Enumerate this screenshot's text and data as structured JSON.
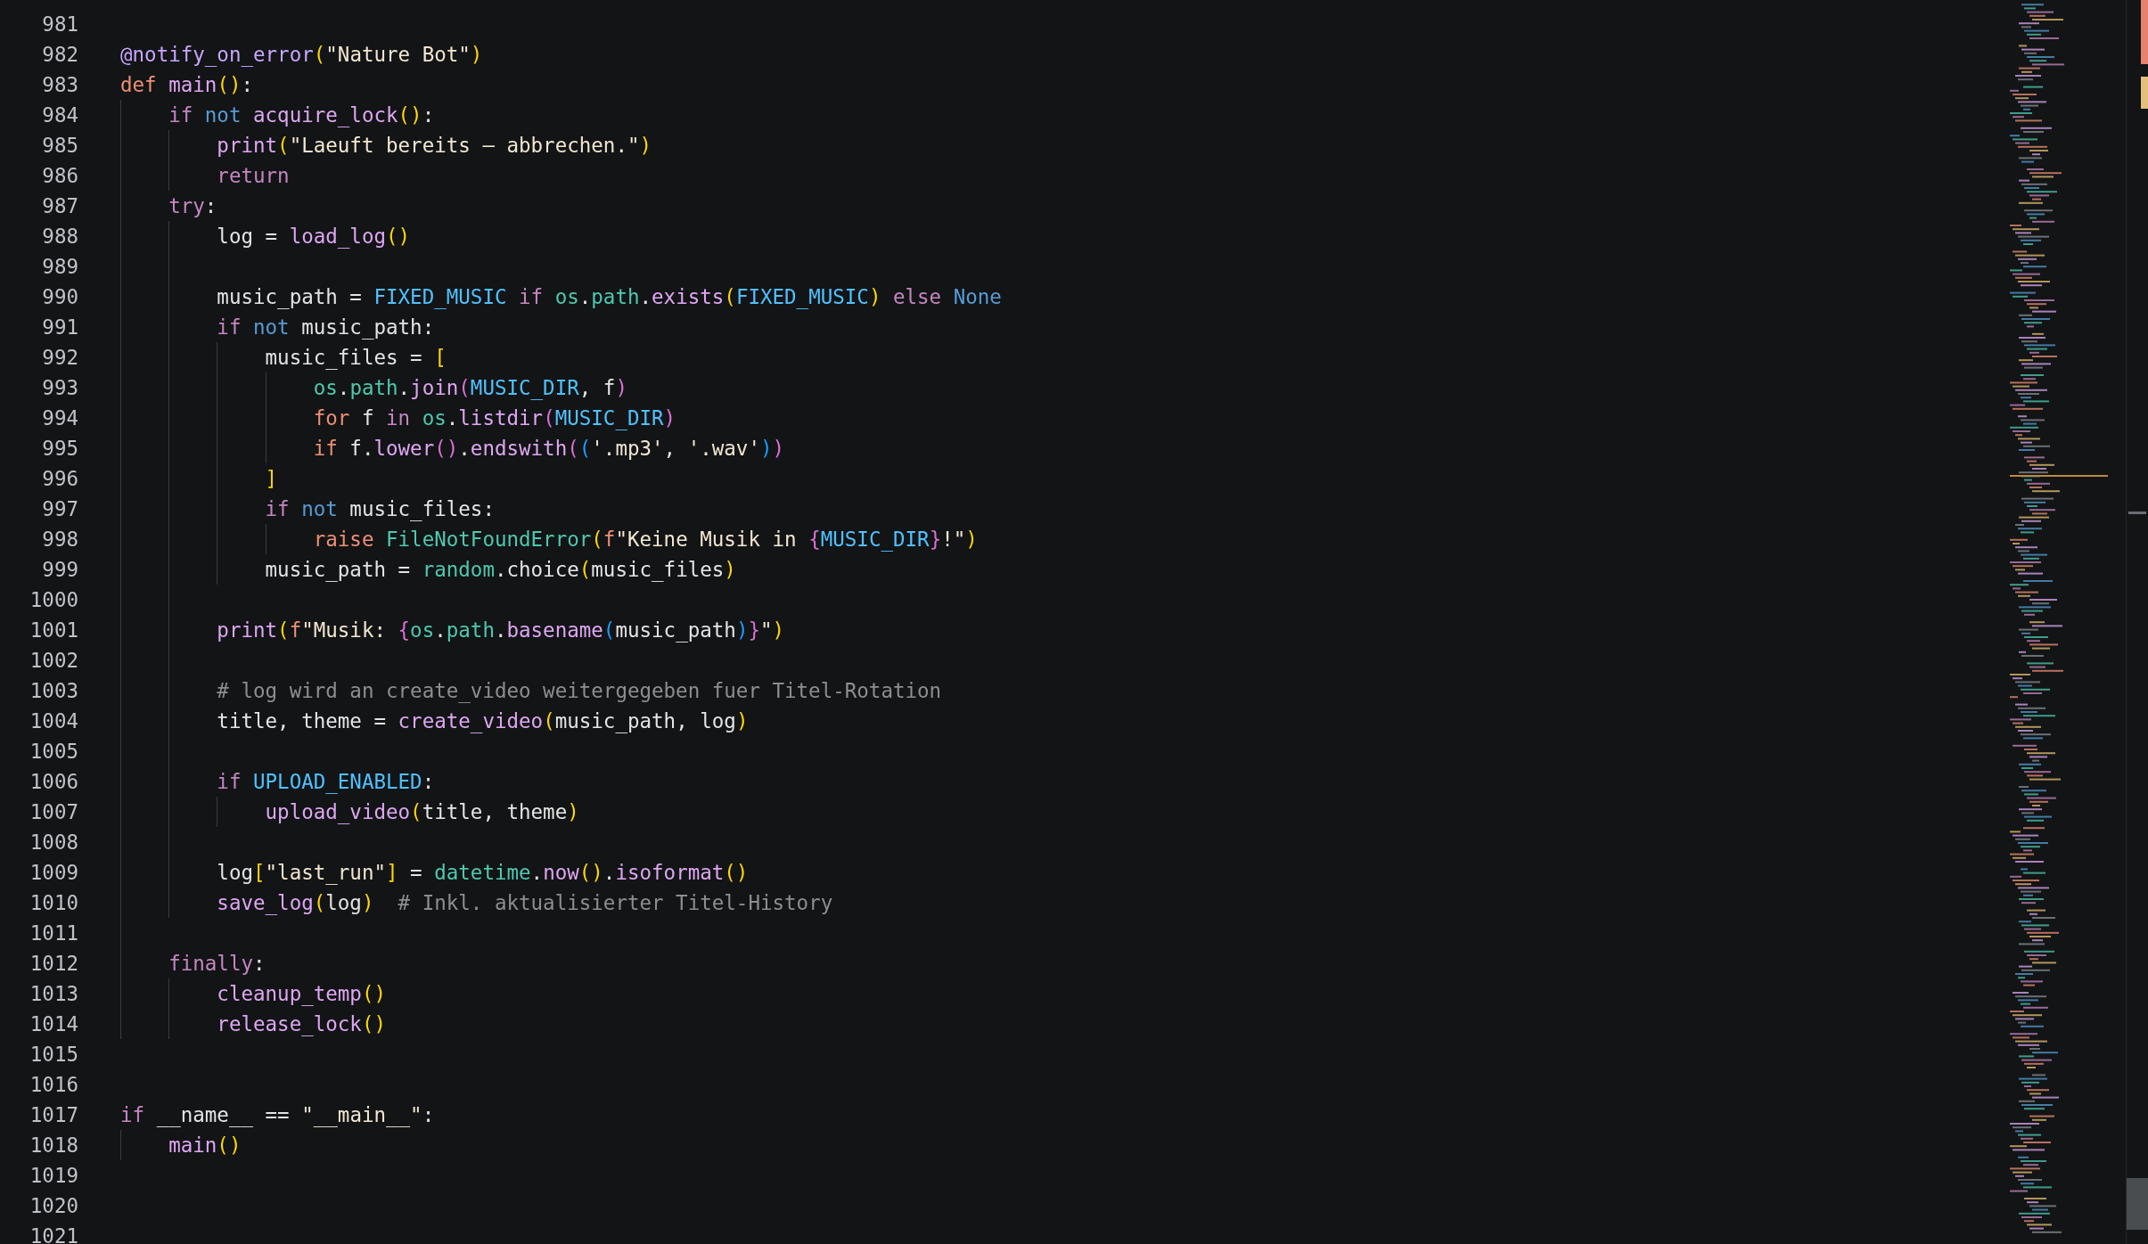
{
  "editor": {
    "lines": [
      {
        "number": "981"
      },
      {
        "number": "982",
        "tokens": [
          {
            "text": "@notify_on_error",
            "kind": "decorator"
          },
          {
            "text": "(",
            "kind": "bracket1"
          },
          {
            "text": "\"Nature Bot\"",
            "kind": "string"
          },
          {
            "text": ")",
            "kind": "bracket1"
          }
        ]
      },
      {
        "number": "983",
        "tokens": [
          {
            "text": "def ",
            "kind": "storage"
          },
          {
            "text": "main",
            "kind": "function"
          },
          {
            "text": "()",
            "kind": "bracket1"
          },
          {
            "text": ":",
            "kind": "plain"
          }
        ]
      },
      {
        "number": "984",
        "tokens": [
          {
            "text": "    if ",
            "kind": "control"
          },
          {
            "text": "not ",
            "kind": "operator"
          },
          {
            "text": "acquire_lock",
            "kind": "function"
          },
          {
            "text": "()",
            "kind": "bracket1"
          },
          {
            "text": ":",
            "kind": "plain"
          }
        ]
      },
      {
        "number": "985",
        "tokens": [
          {
            "text": "        print",
            "kind": "function"
          },
          {
            "text": "(",
            "kind": "bracket1"
          },
          {
            "text": "\"Laeuft bereits – abbrechen.\"",
            "kind": "string"
          },
          {
            "text": ")",
            "kind": "bracket1"
          }
        ]
      },
      {
        "number": "986",
        "tokens": [
          {
            "text": "        return",
            "kind": "control"
          }
        ]
      },
      {
        "number": "987",
        "tokens": [
          {
            "text": "    try",
            "kind": "control"
          },
          {
            "text": ":",
            "kind": "plain"
          }
        ]
      },
      {
        "number": "988",
        "tokens": [
          {
            "text": "        log = ",
            "kind": "plain"
          },
          {
            "text": "load_log",
            "kind": "function"
          },
          {
            "text": "()",
            "kind": "bracket1"
          }
        ]
      },
      {
        "number": "989"
      },
      {
        "number": "990",
        "tokens": [
          {
            "text": "        music_path = ",
            "kind": "plain"
          },
          {
            "text": "FIXED_MUSIC ",
            "kind": "constant"
          },
          {
            "text": "if ",
            "kind": "control"
          },
          {
            "text": "os",
            "kind": "module"
          },
          {
            "text": ".",
            "kind": "plain"
          },
          {
            "text": "path",
            "kind": "module"
          },
          {
            "text": ".",
            "kind": "plain"
          },
          {
            "text": "exists",
            "kind": "function"
          },
          {
            "text": "(",
            "kind": "bracket1"
          },
          {
            "text": "FIXED_MUSIC",
            "kind": "constant"
          },
          {
            "text": ") ",
            "kind": "bracket1"
          },
          {
            "text": "else ",
            "kind": "control"
          },
          {
            "text": "None",
            "kind": "operator"
          }
        ]
      },
      {
        "number": "991",
        "tokens": [
          {
            "text": "        if ",
            "kind": "control"
          },
          {
            "text": "not",
            "kind": "operator"
          },
          {
            "text": " music_path:",
            "kind": "plain"
          }
        ]
      },
      {
        "number": "992",
        "tokens": [
          {
            "text": "            music_files = ",
            "kind": "plain"
          },
          {
            "text": "[",
            "kind": "bracket1"
          }
        ]
      },
      {
        "number": "993",
        "tokens": [
          {
            "text": "                os",
            "kind": "module"
          },
          {
            "text": ".",
            "kind": "plain"
          },
          {
            "text": "path",
            "kind": "module"
          },
          {
            "text": ".",
            "kind": "plain"
          },
          {
            "text": "join",
            "kind": "function"
          },
          {
            "text": "(",
            "kind": "bracket2"
          },
          {
            "text": "MUSIC_DIR",
            "kind": "constant"
          },
          {
            "text": ", f",
            "kind": "plain"
          },
          {
            "text": ")",
            "kind": "bracket2"
          }
        ]
      },
      {
        "number": "994",
        "tokens": [
          {
            "text": "                for",
            "kind": "storage"
          },
          {
            "text": " f ",
            "kind": "plain"
          },
          {
            "text": "in ",
            "kind": "control"
          },
          {
            "text": "os",
            "kind": "module"
          },
          {
            "text": ".",
            "kind": "plain"
          },
          {
            "text": "listdir",
            "kind": "function"
          },
          {
            "text": "(",
            "kind": "bracket2"
          },
          {
            "text": "MUSIC_DIR",
            "kind": "constant"
          },
          {
            "text": ")",
            "kind": "bracket2"
          }
        ]
      },
      {
        "number": "995",
        "tokens": [
          {
            "text": "                if",
            "kind": "storage"
          },
          {
            "text": " f.",
            "kind": "plain"
          },
          {
            "text": "lower",
            "kind": "function"
          },
          {
            "text": "()",
            "kind": "bracket2"
          },
          {
            "text": ".",
            "kind": "plain"
          },
          {
            "text": "endswith",
            "kind": "function"
          },
          {
            "text": "(",
            "kind": "bracket2"
          },
          {
            "text": "(",
            "kind": "bracket3"
          },
          {
            "text": "'.mp3'",
            "kind": "string"
          },
          {
            "text": ", ",
            "kind": "plain"
          },
          {
            "text": "'.wav'",
            "kind": "string"
          },
          {
            "text": ")",
            "kind": "bracket3"
          },
          {
            "text": ")",
            "kind": "bracket2"
          }
        ]
      },
      {
        "number": "996",
        "tokens": [
          {
            "text": "            ]",
            "kind": "bracket1"
          }
        ]
      },
      {
        "number": "997",
        "tokens": [
          {
            "text": "            if ",
            "kind": "control"
          },
          {
            "text": "not",
            "kind": "operator"
          },
          {
            "text": " music_files:",
            "kind": "plain"
          }
        ]
      },
      {
        "number": "998",
        "tokens": [
          {
            "text": "                raise ",
            "kind": "storage"
          },
          {
            "text": "FileNotFoundError",
            "kind": "module"
          },
          {
            "text": "(",
            "kind": "bracket1"
          },
          {
            "text": "f",
            "kind": "storage"
          },
          {
            "text": "\"Keine Musik in ",
            "kind": "string"
          },
          {
            "text": "{",
            "kind": "bracket2"
          },
          {
            "text": "MUSIC_DIR",
            "kind": "constant"
          },
          {
            "text": "}",
            "kind": "bracket2"
          },
          {
            "text": "!\"",
            "kind": "string"
          },
          {
            "text": ")",
            "kind": "bracket1"
          }
        ]
      },
      {
        "number": "999",
        "tokens": [
          {
            "text": "            music_path = ",
            "kind": "plain"
          },
          {
            "text": "random",
            "kind": "module"
          },
          {
            "text": ".",
            "kind": "plain"
          },
          {
            "text": "choice",
            "kind": "plain"
          },
          {
            "text": "(",
            "kind": "bracket1"
          },
          {
            "text": "music_files",
            "kind": "plain"
          },
          {
            "text": ")",
            "kind": "bracket1"
          }
        ]
      },
      {
        "number": "1000"
      },
      {
        "number": "1001",
        "tokens": [
          {
            "text": "        print",
            "kind": "function"
          },
          {
            "text": "(",
            "kind": "bracket1"
          },
          {
            "text": "f",
            "kind": "storage"
          },
          {
            "text": "\"Musik: ",
            "kind": "string"
          },
          {
            "text": "{",
            "kind": "bracket2"
          },
          {
            "text": "os",
            "kind": "module"
          },
          {
            "text": ".",
            "kind": "plain"
          },
          {
            "text": "path",
            "kind": "module"
          },
          {
            "text": ".",
            "kind": "plain"
          },
          {
            "text": "basename",
            "kind": "function"
          },
          {
            "text": "(",
            "kind": "bracket3"
          },
          {
            "text": "music_path",
            "kind": "plain"
          },
          {
            "text": ")",
            "kind": "bracket3"
          },
          {
            "text": "}",
            "kind": "bracket2"
          },
          {
            "text": "\"",
            "kind": "string"
          },
          {
            "text": ")",
            "kind": "bracket1"
          }
        ]
      },
      {
        "number": "1002"
      },
      {
        "number": "1003",
        "tokens": [
          {
            "text": "        # log wird an create_video weitergegeben fuer Titel-Rotation",
            "kind": "comment"
          }
        ]
      },
      {
        "number": "1004",
        "tokens": [
          {
            "text": "        title, theme = ",
            "kind": "plain"
          },
          {
            "text": "create_video",
            "kind": "function"
          },
          {
            "text": "(",
            "kind": "bracket1"
          },
          {
            "text": "music_path, log",
            "kind": "plain"
          },
          {
            "text": ")",
            "kind": "bracket1"
          }
        ]
      },
      {
        "number": "1005"
      },
      {
        "number": "1006",
        "tokens": [
          {
            "text": "        if ",
            "kind": "control"
          },
          {
            "text": "UPLOAD_ENABLED",
            "kind": "constant"
          },
          {
            "text": ":",
            "kind": "plain"
          }
        ]
      },
      {
        "number": "1007",
        "tokens": [
          {
            "text": "            upload_video",
            "kind": "function"
          },
          {
            "text": "(",
            "kind": "bracket1"
          },
          {
            "text": "title, theme",
            "kind": "plain"
          },
          {
            "text": ")",
            "kind": "bracket1"
          }
        ]
      },
      {
        "number": "1008"
      },
      {
        "number": "1009",
        "tokens": [
          {
            "text": "        log",
            "kind": "plain"
          },
          {
            "text": "[",
            "kind": "bracket1"
          },
          {
            "text": "\"last_run\"",
            "kind": "string"
          },
          {
            "text": "]",
            "kind": "bracket1"
          },
          {
            "text": " = ",
            "kind": "plain"
          },
          {
            "text": "datetime",
            "kind": "module"
          },
          {
            "text": ".",
            "kind": "plain"
          },
          {
            "text": "now",
            "kind": "function"
          },
          {
            "text": "()",
            "kind": "bracket1"
          },
          {
            "text": ".",
            "kind": "plain"
          },
          {
            "text": "isoformat",
            "kind": "function"
          },
          {
            "text": "()",
            "kind": "bracket1"
          }
        ]
      },
      {
        "number": "1010",
        "tokens": [
          {
            "text": "        save_log",
            "kind": "function"
          },
          {
            "text": "(",
            "kind": "bracket1"
          },
          {
            "text": "log",
            "kind": "plain"
          },
          {
            "text": ")",
            "kind": "bracket1"
          },
          {
            "text": "  # Inkl. aktualisierter Titel-History",
            "kind": "comment"
          }
        ]
      },
      {
        "number": "1011"
      },
      {
        "number": "1012",
        "tokens": [
          {
            "text": "    finally",
            "kind": "control"
          },
          {
            "text": ":",
            "kind": "plain"
          }
        ]
      },
      {
        "number": "1013",
        "tokens": [
          {
            "text": "        cleanup_temp",
            "kind": "function"
          },
          {
            "text": "()",
            "kind": "bracket1"
          }
        ]
      },
      {
        "number": "1014",
        "tokens": [
          {
            "text": "        release_lock",
            "kind": "function"
          },
          {
            "text": "()",
            "kind": "bracket1"
          }
        ]
      },
      {
        "number": "1015"
      },
      {
        "number": "1016"
      },
      {
        "number": "1017",
        "tokens": [
          {
            "text": "if",
            "kind": "control"
          },
          {
            "text": " __name__ == ",
            "kind": "plain"
          },
          {
            "text": "\"__main__\"",
            "kind": "string"
          },
          {
            "text": ":",
            "kind": "plain"
          }
        ]
      },
      {
        "number": "1018",
        "tokens": [
          {
            "text": "    main",
            "kind": "function"
          },
          {
            "text": "()",
            "kind": "bracket1"
          }
        ]
      },
      {
        "number": "1019"
      },
      {
        "number": "1020"
      },
      {
        "number": "1021"
      }
    ]
  }
}
